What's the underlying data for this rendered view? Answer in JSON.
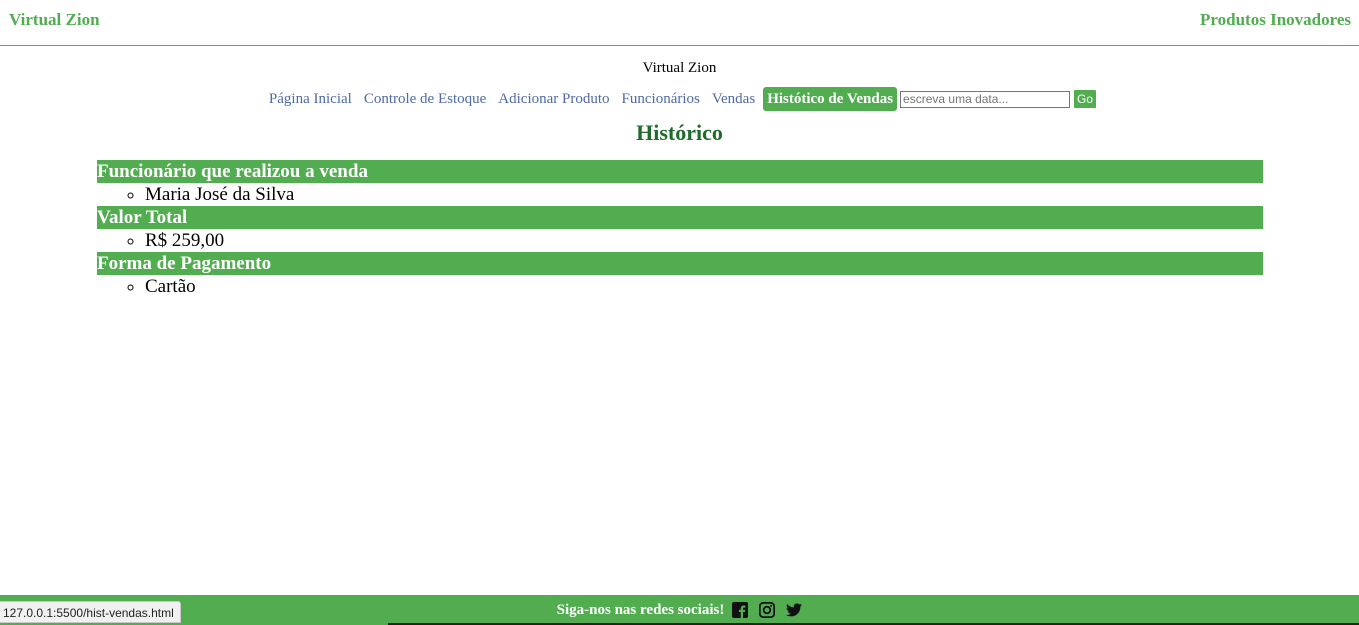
{
  "header": {
    "brand_left": "Virtual Zion",
    "brand_right": "Produtos Inovadores"
  },
  "site_name": "Virtual Zion",
  "nav": {
    "items": [
      {
        "label": "Página Inicial",
        "active": false
      },
      {
        "label": "Controle de Estoque",
        "active": false
      },
      {
        "label": "Adicionar Produto",
        "active": false
      },
      {
        "label": "Funcionários",
        "active": false
      },
      {
        "label": "Vendas",
        "active": false
      },
      {
        "label": "Histótico de Vendas",
        "active": true
      }
    ],
    "search_placeholder": "escreva uma data...",
    "search_value": "",
    "go_label": "Go"
  },
  "main": {
    "title": "Histórico",
    "sections": [
      {
        "heading": "Funcionário que realizou a venda",
        "items": [
          "Maria José da Silva"
        ]
      },
      {
        "heading": "Valor Total",
        "items": [
          "R$ 259,00"
        ]
      },
      {
        "heading": "Forma de Pagamento",
        "items": [
          "Cartão"
        ]
      }
    ]
  },
  "footer": {
    "text": "Siga-nos nas redes sociais!",
    "icons": [
      "facebook-icon",
      "instagram-icon",
      "twitter-icon"
    ]
  },
  "status_bar": {
    "url": "127.0.0.1:5500/hist-vendas.html"
  },
  "colors": {
    "accent": "#52ad51",
    "title": "#1e6b2c",
    "link": "#4f6aa5"
  }
}
